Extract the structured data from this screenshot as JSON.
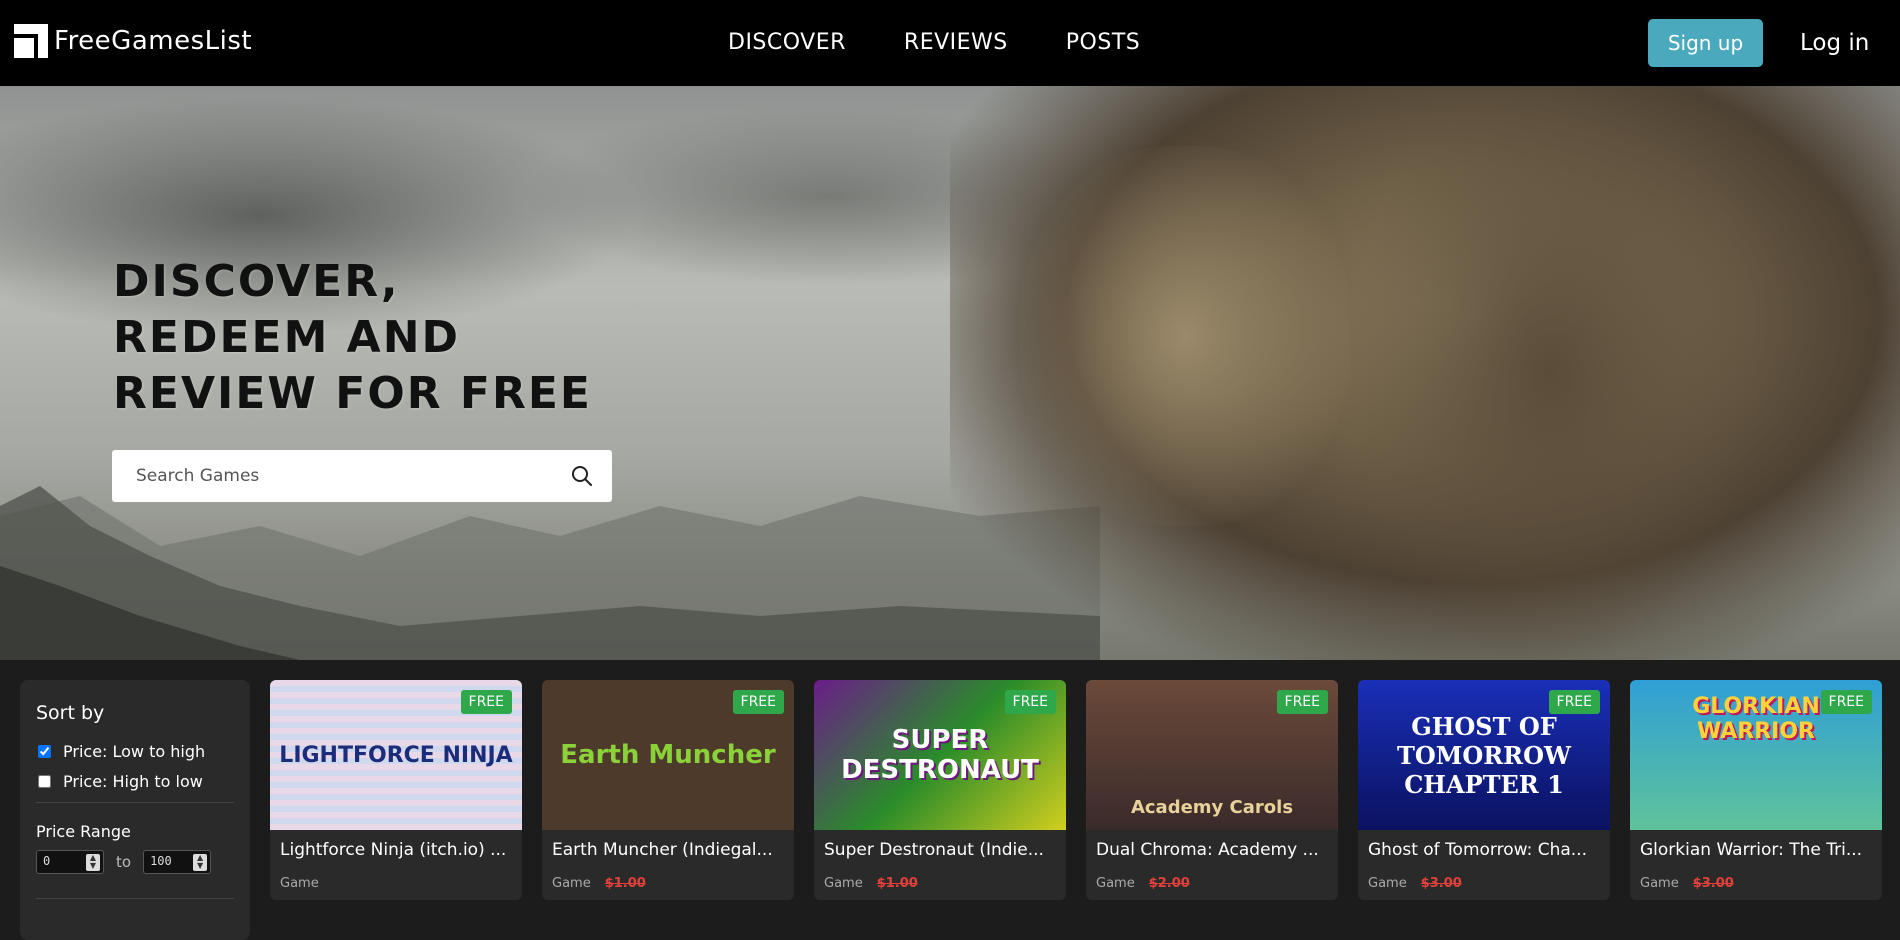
{
  "nav": {
    "logo_text": "FreeGamesList",
    "links": [
      "DISCOVER",
      "REVIEWS",
      "POSTS"
    ],
    "signup_label": "Sign up",
    "login_label": "Log in"
  },
  "hero": {
    "title": "DISCOVER, REDEEM AND REVIEW FOR FREE",
    "search_placeholder": "Search Games"
  },
  "sidebar": {
    "sort_heading": "Sort by",
    "sort_options": [
      {
        "label": "Price: Low to high",
        "checked": true
      },
      {
        "label": "Price: High to low",
        "checked": false
      }
    ],
    "range_heading": "Price Range",
    "range_min": "0",
    "range_to": "to",
    "range_max": "100"
  },
  "games": [
    {
      "title": "Lightforce Ninja (itch.io) ...",
      "badge": "FREE",
      "type": "Game",
      "old_price": "",
      "thumb_text": "LIGHTFORCE NINJA"
    },
    {
      "title": "Earth Muncher (Indiegal...",
      "badge": "FREE",
      "type": "Game",
      "old_price": "$1.00",
      "thumb_text": "Earth Muncher"
    },
    {
      "title": "Super Destronaut (Indie...",
      "badge": "FREE",
      "type": "Game",
      "old_price": "$1.00",
      "thumb_text": "SUPER DESTRONAUT"
    },
    {
      "title": "Dual Chroma: Academy ...",
      "badge": "FREE",
      "type": "Game",
      "old_price": "$2.00",
      "thumb_text": "Academy Carols"
    },
    {
      "title": "Ghost of Tomorrow: Cha...",
      "badge": "FREE",
      "type": "Game",
      "old_price": "$3.00",
      "thumb_text": "GHOST OF TOMORROW CHAPTER 1"
    },
    {
      "title": "Glorkian Warrior: The Tri...",
      "badge": "FREE",
      "type": "Game",
      "old_price": "$3.00",
      "thumb_text": "GLORKIAN WARRIOR"
    }
  ],
  "colors": {
    "accent": "#4aa9bc",
    "free_badge": "#2ea84a",
    "strike_price": "#e0413b"
  }
}
